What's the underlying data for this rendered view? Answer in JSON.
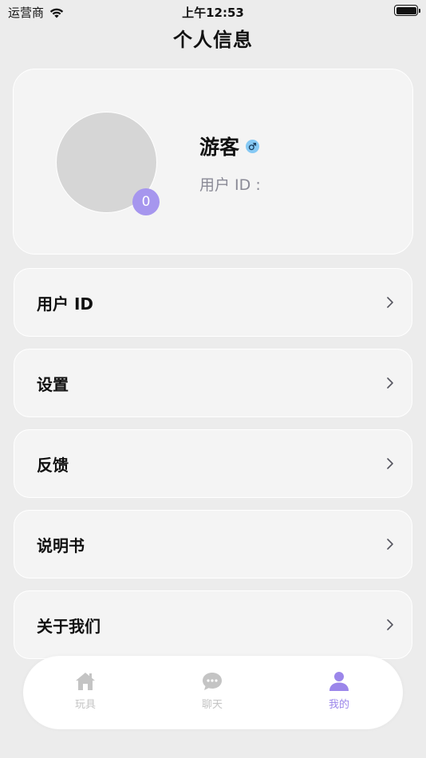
{
  "status_bar": {
    "carrier": "运营商",
    "time": "上午12:53",
    "battery_level": 1.0
  },
  "header": {
    "title": "个人信息"
  },
  "profile": {
    "name": "游客",
    "gender_icon": "male-icon",
    "user_id_label": "用户 ID :",
    "level": "0"
  },
  "menu": {
    "items": [
      {
        "label": "用户 ID"
      },
      {
        "label": "设置"
      },
      {
        "label": "反馈"
      },
      {
        "label": "说明书"
      },
      {
        "label": "关于我们"
      }
    ]
  },
  "tab_bar": {
    "tabs": [
      {
        "label": "玩具",
        "icon": "home-icon"
      },
      {
        "label": "聊天",
        "icon": "chat-icon"
      },
      {
        "label": "我的",
        "icon": "person-icon",
        "active": true
      }
    ]
  },
  "colors": {
    "accent": "#9b86ea",
    "badge": "#a696ee",
    "gender": "#86c9f4",
    "inactive_tab": "#c4c4c4"
  }
}
